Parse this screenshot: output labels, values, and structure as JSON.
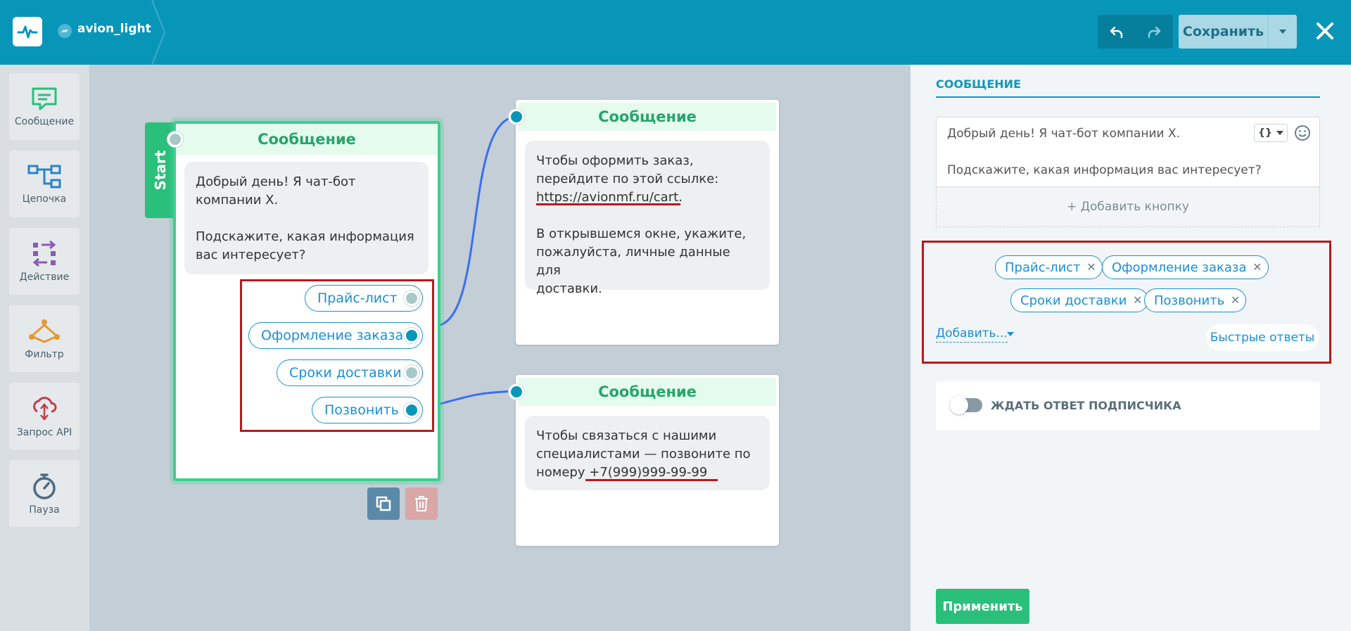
{
  "header": {
    "bot_name": "avion_light",
    "save_label": "Сохранить"
  },
  "tools": [
    {
      "label": "Сообщение",
      "icon": "message-icon"
    },
    {
      "label": "Цепочка",
      "icon": "chain-icon"
    },
    {
      "label": "Действие",
      "icon": "action-icon"
    },
    {
      "label": "Фильтр",
      "icon": "filter-icon"
    },
    {
      "label": "Запрос API",
      "icon": "api-icon"
    },
    {
      "label": "Пауза",
      "icon": "pause-icon"
    }
  ],
  "canvas": {
    "start_label": "Start",
    "node1": {
      "title": "Сообщение",
      "text1": "Добрый день! Я чат-бот",
      "text2": "компании Х.",
      "text3": "Подскажите, какая информация",
      "text4": "вас интересует?",
      "buttons": [
        "Прайс-лист",
        "Оформление заказа",
        "Сроки доставки",
        "Позвонить"
      ]
    },
    "node2": {
      "title": "Сообщение",
      "line1": "Чтобы оформить заказ,",
      "line2": "перейдите по этой ссылке:",
      "link": "https://avionmf.ru/cart.",
      "line3": "В открывшемся окне, укажите,",
      "line4": "пожалуйста, личные данные для",
      "line5": "доставки."
    },
    "node3": {
      "title": "Сообщение",
      "line1": "Чтобы связаться с нашими",
      "line2": "специалистами — позвоните по",
      "line3": "номеру",
      "phone": "+7(999)999-99-99"
    }
  },
  "panel": {
    "title": "СООБЩЕНИЕ",
    "text_line1": "Добрый день! Я чат-бот компании Х.",
    "text_line2": "Подскажите, какая информация вас интересует?",
    "var_label": "{}",
    "add_button_label": "+ Добавить кнопку",
    "quick_replies": [
      "Прайс-лист",
      "Оформление заказа",
      "Сроки доставки",
      "Позвонить"
    ],
    "add_label": "Добавить...",
    "quick_label": "Быстрые ответы",
    "wait_label": "ЖДАТЬ ОТВЕТ ПОДПИСЧИКА",
    "apply_label": "Применить"
  },
  "colors": {
    "brand": "#0896b8",
    "green": "#2bbf7c",
    "link": "#1a8fd8",
    "highlight": "#b8191c"
  }
}
